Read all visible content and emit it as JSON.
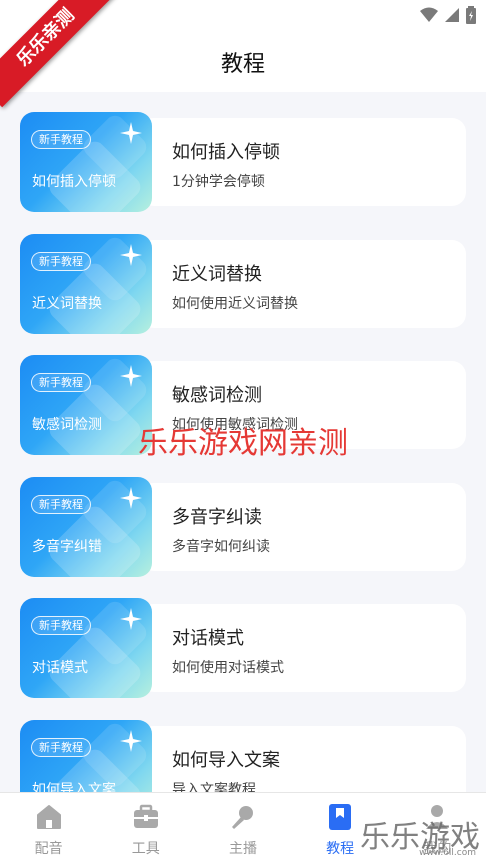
{
  "header": {
    "title": "教程"
  },
  "watermarks": {
    "ribbon": "乐乐亲测",
    "center": "乐乐游戏网亲测",
    "corner": "乐乐游戏",
    "corner_url": "www.6ll.com"
  },
  "cards": [
    {
      "badge": "新手教程",
      "thumb_title": "如何插入停顿",
      "title": "如何插入停顿",
      "subtitle": "1分钟学会停顿"
    },
    {
      "badge": "新手教程",
      "thumb_title": "近义词替换",
      "title": "近义词替换",
      "subtitle": "如何使用近义词替换"
    },
    {
      "badge": "新手教程",
      "thumb_title": "敏感词检测",
      "title": "敏感词检测",
      "subtitle": "如何使用敏感词检测"
    },
    {
      "badge": "新手教程",
      "thumb_title": "多音字纠错",
      "title": "多音字纠读",
      "subtitle": "多音字如何纠读"
    },
    {
      "badge": "新手教程",
      "thumb_title": "对话模式",
      "title": "对话模式",
      "subtitle": "如何使用对话模式"
    },
    {
      "badge": "新手教程",
      "thumb_title": "如何导入文案",
      "title": "如何导入文案",
      "subtitle": "导入文案教程"
    }
  ],
  "tabs": [
    {
      "label": "配音",
      "icon": "home-icon"
    },
    {
      "label": "工具",
      "icon": "toolbox-icon"
    },
    {
      "label": "主播",
      "icon": "microphone-icon"
    },
    {
      "label": "教程",
      "icon": "bookmark-icon",
      "active": true
    },
    {
      "label": "我的",
      "icon": "profile-icon"
    }
  ],
  "colors": {
    "accent": "#2a6df4",
    "thumb_gradient_start": "#1c8cf4",
    "thumb_gradient_end": "#b6f0de",
    "watermark_red": "#e53935"
  }
}
